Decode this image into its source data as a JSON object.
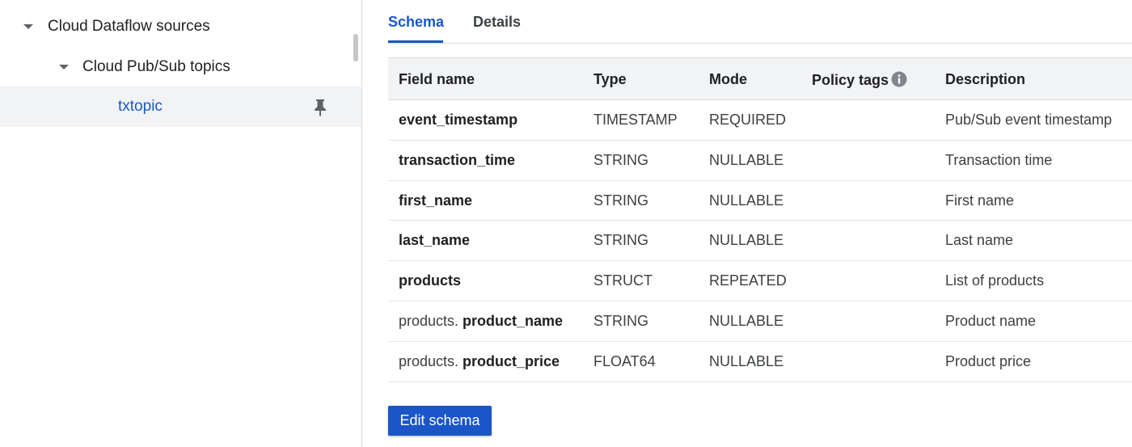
{
  "tree": {
    "root_label": "Cloud Dataflow sources",
    "child_label": "Cloud Pub/Sub topics",
    "selected_label": "txtopic",
    "pin_icon": "pin-icon"
  },
  "tabs": [
    {
      "label": "Schema",
      "active": true
    },
    {
      "label": "Details",
      "active": false
    }
  ],
  "table": {
    "headers": [
      "Field name",
      "Type",
      "Mode",
      "Policy tags",
      "Description"
    ],
    "rows": [
      {
        "prefix": "",
        "name": "event_timestamp",
        "type": "TIMESTAMP",
        "mode": "REQUIRED",
        "policy_tags": "",
        "description": "Pub/Sub event timestamp"
      },
      {
        "prefix": "",
        "name": "transaction_time",
        "type": "STRING",
        "mode": "NULLABLE",
        "policy_tags": "",
        "description": "Transaction time"
      },
      {
        "prefix": "",
        "name": "first_name",
        "type": "STRING",
        "mode": "NULLABLE",
        "policy_tags": "",
        "description": "First name"
      },
      {
        "prefix": "",
        "name": "last_name",
        "type": "STRING",
        "mode": "NULLABLE",
        "policy_tags": "",
        "description": "Last name"
      },
      {
        "prefix": "",
        "name": "products",
        "type": "STRUCT",
        "mode": "REPEATED",
        "policy_tags": "",
        "description": "List of products"
      },
      {
        "prefix": "products. ",
        "name": "product_name",
        "type": "STRING",
        "mode": "NULLABLE",
        "policy_tags": "",
        "description": "Product name"
      },
      {
        "prefix": "products. ",
        "name": "product_price",
        "type": "FLOAT64",
        "mode": "NULLABLE",
        "policy_tags": "",
        "description": "Product price"
      }
    ]
  },
  "actions": {
    "edit_schema_label": "Edit schema"
  },
  "colors": {
    "accent": "#1a56c8",
    "selected_row_bg": "#f1f3f4",
    "header_bg": "#f1f3f4"
  }
}
